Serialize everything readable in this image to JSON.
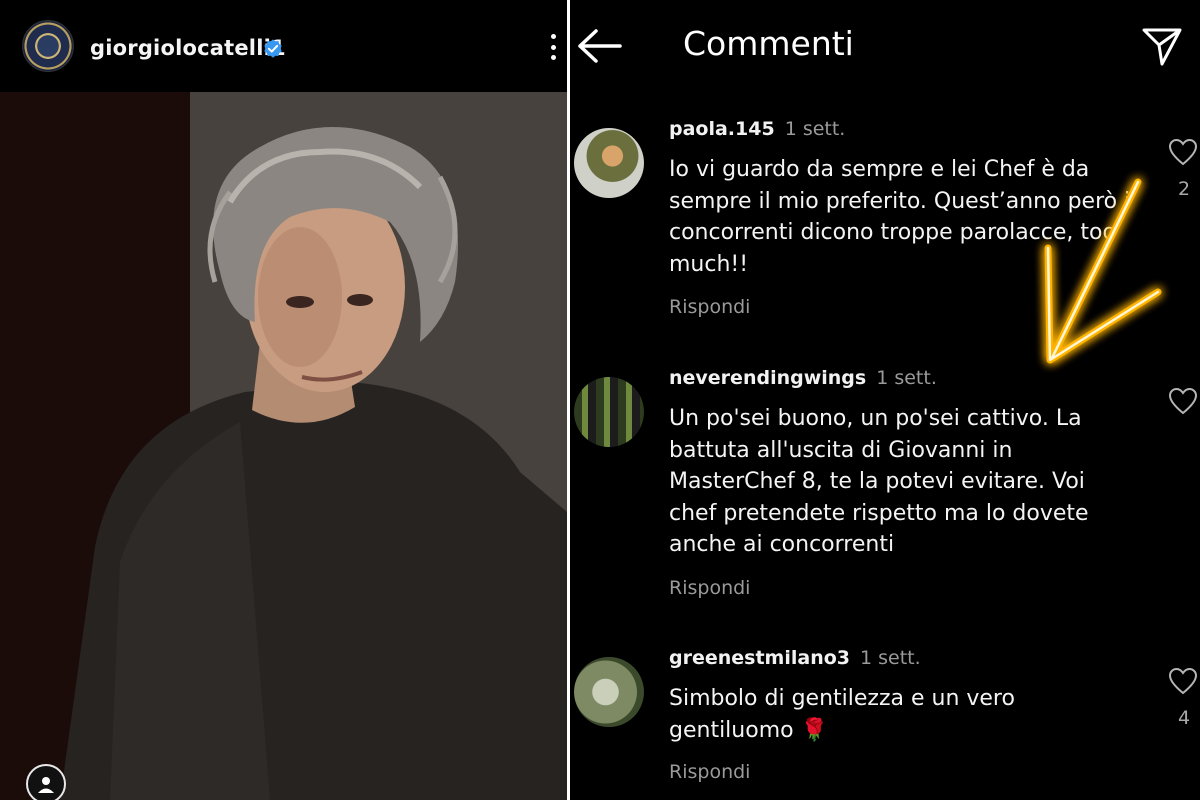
{
  "post": {
    "username": "giorgiolocatelli1",
    "verified": true,
    "icons": [
      "profile-avatar",
      "verified-badge-icon",
      "more-options-icon",
      "tagged-people-icon"
    ]
  },
  "comments_panel": {
    "title": "Commenti",
    "icons": [
      "back-arrow-icon",
      "send-icon",
      "heart-icon"
    ],
    "comments": [
      {
        "username": "paola.145",
        "time": "1 sett.",
        "text": "Io vi guardo da sempre e lei Chef è da sempre il mio preferito. Quest’anno però i concorrenti dicono troppe parolacce, too much!!",
        "reply_label": "Rispondi",
        "likes": "2"
      },
      {
        "username": "neverendingwings",
        "time": "1 sett.",
        "text": "Un po'sei buono, un po'sei cattivo. La battuta all'uscita di Giovanni in MasterChef 8, te la potevi evitare. Voi chef pretendete rispetto ma lo dovete anche ai concorrenti",
        "reply_label": "Rispondi",
        "likes": ""
      },
      {
        "username": "greenestmilano3",
        "time": "1 sett.",
        "text": "Simbolo di gentilezza e un vero gentiluomo 🌹",
        "reply_label": "Rispondi",
        "likes": "4"
      }
    ]
  },
  "colors": {
    "background": "#000000",
    "verified_blue": "#3897f0",
    "muted_text": "#9a9a9a",
    "arrow_glow": "#ffb400"
  }
}
